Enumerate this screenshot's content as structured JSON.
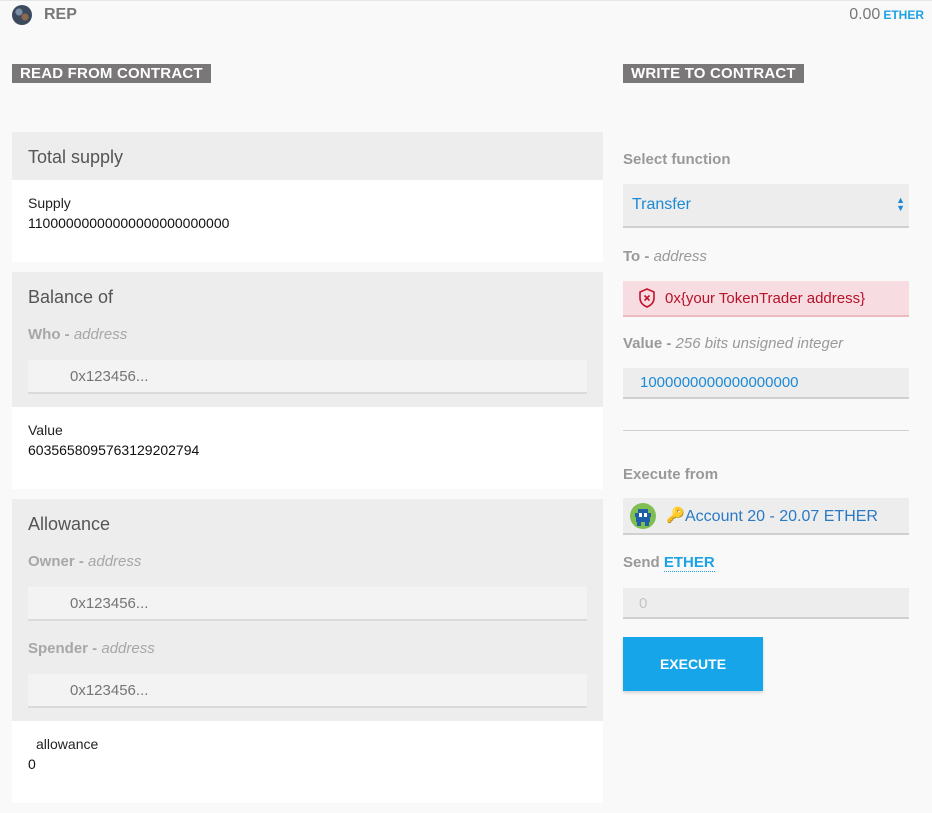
{
  "header": {
    "token_name": "REP",
    "balance_amount": "0.00",
    "balance_unit": "ETHER",
    "token_icon": "rep-token-icon"
  },
  "read": {
    "section_label": "READ FROM CONTRACT",
    "total_supply": {
      "title": "Total supply",
      "result_label": "Supply",
      "result_value": "11000000000000000000000000"
    },
    "balance_of": {
      "title": "Balance of",
      "who_label": "Who",
      "who_type": "address",
      "who_placeholder": "0x123456...",
      "result_label": "Value",
      "result_value": "6035658095763129202794"
    },
    "allowance": {
      "title": "Allowance",
      "owner_label": "Owner",
      "owner_type": "address",
      "owner_placeholder": "0x123456...",
      "spender_label": "Spender",
      "spender_type": "address",
      "spender_placeholder": "0x123456...",
      "result_label": "allowance",
      "result_value": "0"
    }
  },
  "write": {
    "section_label": "WRITE TO CONTRACT",
    "select_function_label": "Select function",
    "selected_function": "Transfer",
    "to_label": "To",
    "to_type": "address",
    "to_value": "0x{your TokenTrader address}",
    "value_label": "Value",
    "value_type": "256 bits unsigned integer",
    "value_value": "1000000000000000000",
    "execute_from_label": "Execute from",
    "account_text": "Account 20 - 20.07 ETHER",
    "send_label": "Send",
    "send_unit": "ETHER",
    "send_placeholder": "0",
    "execute_button": "EXECUTE"
  },
  "colors": {
    "accent": "#16a5e8",
    "link": "#1a8ad8",
    "error_bg": "#f7dde1",
    "error_text": "#b8112a",
    "section_label_bg": "#797777"
  }
}
